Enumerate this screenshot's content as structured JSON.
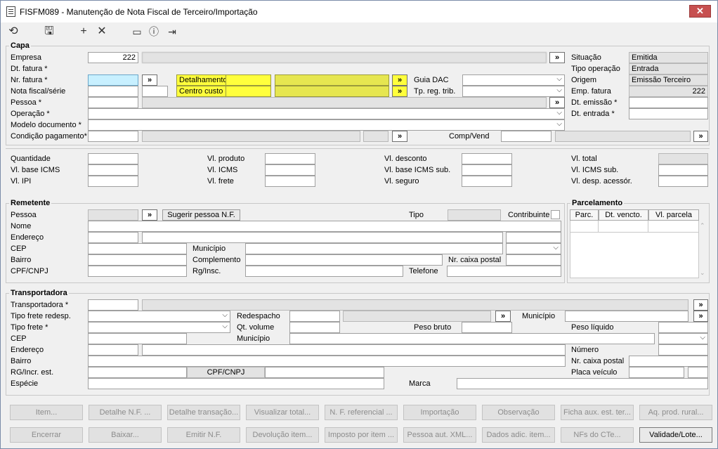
{
  "window": {
    "title": "FISFM089 - Manutenção de Nota Fiscal de Terceiro/Importação",
    "close_label": "✕"
  },
  "toolbar": {
    "icons": [
      "refresh-icon",
      "save-icon",
      "add-icon",
      "delete-icon",
      "calendar-icon",
      "help-icon",
      "exit-icon"
    ]
  },
  "capa": {
    "title": "Capa",
    "empresa_label": "Empresa",
    "empresa_value": "222",
    "dt_fatura_label": "Dt. fatura *",
    "nr_fatura_label": "Nr. fatura *",
    "nota_serie_label": "Nota fiscal/série",
    "pessoa_label": "Pessoa *",
    "operacao_label": "Operação *",
    "modelo_label": "Modelo documento *",
    "condicao_label": "Condição pagamento*",
    "detalhamento_label": "Detalhamento",
    "centro_custo_label": "Centro custo",
    "guia_dac_label": "Guia DAC",
    "tp_reg_label": "Tp. reg. trib.",
    "comp_vend_label": "Comp/Vend",
    "situacao_label": "Situação",
    "situacao_value": "Emitida",
    "tipo_op_label": "Tipo operação",
    "tipo_op_value": "Entrada",
    "origem_label": "Origem",
    "origem_value": "Emissão Terceiro",
    "emp_fatura_label": "Emp. fatura",
    "emp_fatura_value": "222",
    "dt_emissao_label": "Dt. emissão *",
    "dt_entrada_label": "Dt. entrada *",
    "lookup": "»"
  },
  "totais": {
    "quantidade": "Quantidade",
    "vl_base_icms": "Vl. base ICMS",
    "vl_ipi": "Vl. IPI",
    "vl_produto": "Vl. produto",
    "vl_icms": "Vl. ICMS",
    "vl_frete": "Vl. frete",
    "vl_desconto": "Vl. desconto",
    "vl_base_icms_sub": "Vl. base ICMS sub.",
    "vl_seguro": "Vl. seguro",
    "vl_total": "Vl. total",
    "vl_icms_sub": "Vl. ICMS sub.",
    "vl_desp": "Vl. desp. acessór."
  },
  "remetente": {
    "title": "Remetente",
    "pessoa": "Pessoa",
    "sugerir": "Sugerir pessoa N.F.",
    "tipo": "Tipo",
    "contribuinte": "Contribuinte",
    "nome": "Nome",
    "endereco": "Endereço",
    "cep": "CEP",
    "municipio": "Município",
    "bairro": "Bairro",
    "complemento": "Complemento",
    "nr_caixa": "Nr. caixa postal",
    "cpf": "CPF/CNPJ",
    "rg": "Rg/Insc.",
    "telefone": "Telefone"
  },
  "parcelamento": {
    "title": "Parcelamento",
    "cols": [
      "Parc.",
      "Dt. vencto.",
      "Vl. parcela"
    ]
  },
  "transportadora": {
    "title": "Transportadora",
    "transportadora": "Transportadora *",
    "tipo_frete_redesp": "Tipo frete redesp.",
    "tipo_frete": "Tipo frete *",
    "cep": "CEP",
    "endereco": "Endereço",
    "bairro": "Bairro",
    "rg": "RG/Incr. est.",
    "especie": "Espécie",
    "redespacho": "Redespacho",
    "qt_volume": "Qt. volume",
    "municipio": "Município",
    "municipio2": "Município",
    "peso_bruto": "Peso bruto",
    "peso_liquido": "Peso líquido",
    "cpf": "CPF/CNPJ",
    "numero": "Número",
    "nr_caixa": "Nr. caixa postal",
    "placa": "Placa veículo",
    "marca": "Marca"
  },
  "buttons_row1": [
    "Item...",
    "Detalhe N.F. ...",
    "Detalhe transação...",
    "Visualizar total...",
    "N. F. referencial ...",
    "Importação",
    "Observação",
    "Ficha aux. est. ter...",
    "Aq. prod. rural..."
  ],
  "buttons_row2": [
    "Encerrar",
    "Baixar...",
    "Emitir N.F.",
    "Devolução item...",
    "Imposto por item ...",
    "Pessoa aut. XML...",
    "Dados adic. item...",
    "NFs do CTe...",
    "Validade/Lote..."
  ]
}
